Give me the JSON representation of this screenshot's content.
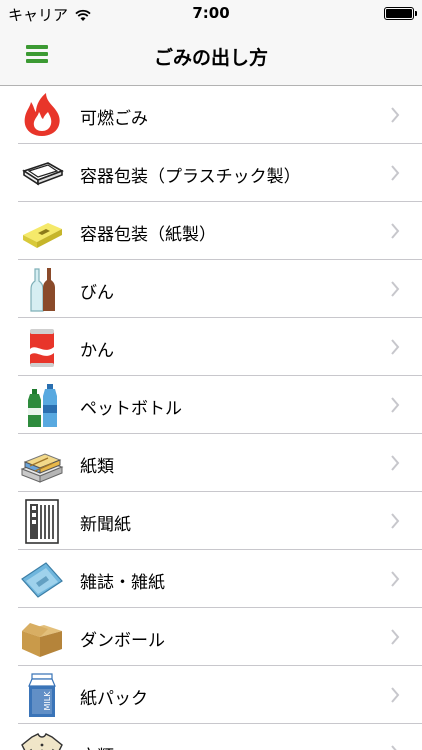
{
  "status_bar": {
    "carrier": "キャリア",
    "time": "7:00",
    "battery_level": 1.0
  },
  "nav": {
    "title": "ごみの出し方",
    "menu_icon": "hamburger-menu-icon"
  },
  "items": [
    {
      "label": "可燃ごみ",
      "icon": "fire-icon"
    },
    {
      "label": "容器包装（プラスチック製）",
      "icon": "plastic-tray-icon"
    },
    {
      "label": "容器包装（紙製）",
      "icon": "paper-box-icon"
    },
    {
      "label": "びん",
      "icon": "bottles-icon"
    },
    {
      "label": "かん",
      "icon": "can-icon"
    },
    {
      "label": "ペットボトル",
      "icon": "pet-bottle-icon"
    },
    {
      "label": "紙類",
      "icon": "paper-bundle-icon"
    },
    {
      "label": "新聞紙",
      "icon": "newspaper-icon"
    },
    {
      "label": "雑誌・雑紙",
      "icon": "magazine-icon"
    },
    {
      "label": "ダンボール",
      "icon": "cardboard-box-icon"
    },
    {
      "label": "紙パック",
      "icon": "milk-carton-icon"
    },
    {
      "label": "衣類",
      "icon": "clothing-icon"
    }
  ],
  "colors": {
    "accent": "#3c9a33",
    "fire": "#e8352a",
    "separator": "#c8c7cc",
    "chevron": "#c7c7cc"
  }
}
